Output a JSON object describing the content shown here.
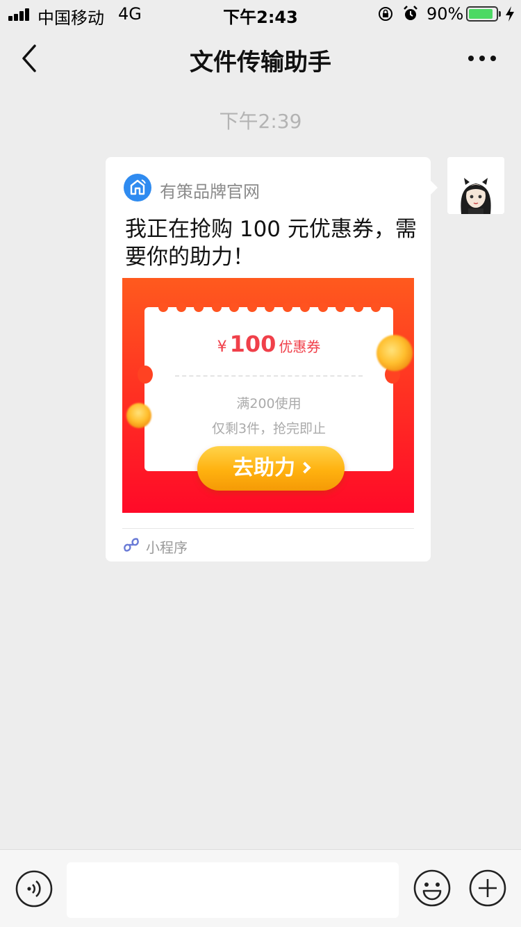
{
  "status_bar": {
    "carrier": "中国移动",
    "network": "4G",
    "time": "下午2:43",
    "battery_percent": "90%",
    "battery_level": 0.9,
    "icons": [
      "signal-icon",
      "lock-rotation-icon",
      "alarm-icon",
      "battery-icon",
      "charging-bolt-icon"
    ]
  },
  "nav": {
    "title": "文件传输助手",
    "icons": [
      "back-chevron-icon",
      "more-dots-icon"
    ]
  },
  "chat": {
    "timestamp": "下午2:39",
    "message": {
      "brand_name": "有策品牌官网",
      "text": "我正在抢购 100 元优惠券，需要你的助力！",
      "coupon": {
        "currency": "¥",
        "amount": "100",
        "unit": "优惠券",
        "condition": "满200使用",
        "stock_note": "仅剩3件，抢完即止",
        "button_label": "去助力"
      },
      "source_label": "小程序"
    }
  },
  "input_bar": {
    "value": "",
    "placeholder": "",
    "icons": [
      "voice-icon",
      "emoji-icon",
      "plus-icon"
    ]
  },
  "colors": {
    "background": "#ededed",
    "promo_top": "#ff5a1e",
    "promo_bottom": "#ff0a28",
    "coupon_text": "#f0404a",
    "button_gold": "#ffb10f",
    "battery_green": "#4cd964"
  }
}
